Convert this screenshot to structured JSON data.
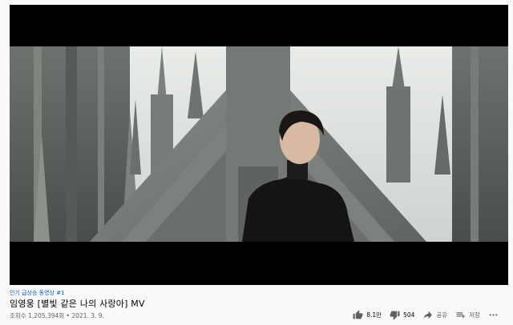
{
  "video": {
    "hashtags": "인기 급상승 동영상 #1",
    "title": "임영웅 [별빛 같은 나의 사랑아] MV",
    "views": "조회수 1,205,394회",
    "separator": "•",
    "date": "2021. 3. 9."
  },
  "actions": {
    "like_count": "8.1만",
    "dislike_count": "504",
    "share_label": "공유",
    "save_label": "저장",
    "icons": [
      "thumb-up-icon",
      "thumb-down-icon",
      "share-icon",
      "save-playlist-icon",
      "more-icon"
    ]
  },
  "colors": {
    "link": "#065fd4",
    "title": "#030303",
    "secondary": "#606060",
    "page_bg": "#f9f9f9",
    "letterbox": "#000000"
  }
}
